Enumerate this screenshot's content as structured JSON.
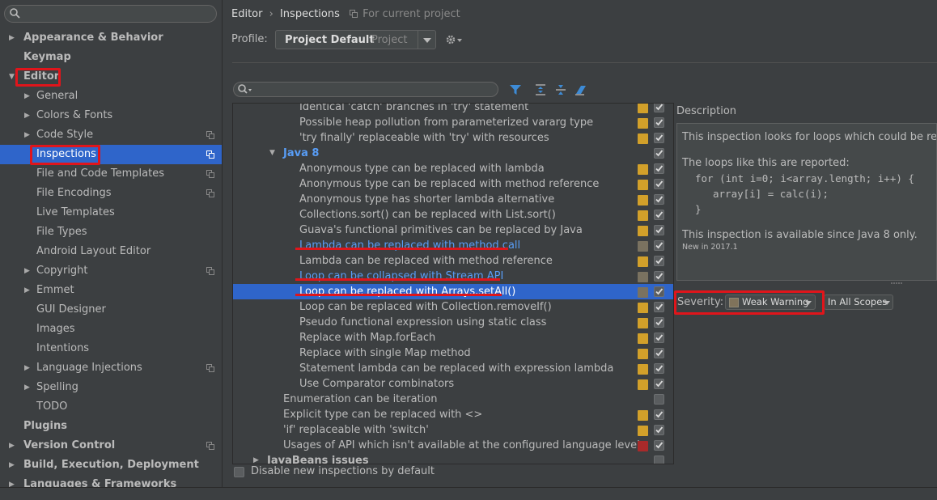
{
  "sidebar": {
    "items": [
      {
        "label": "Appearance & Behavior",
        "bold": true,
        "arrow": "▶"
      },
      {
        "label": "Keymap",
        "bold": true,
        "arrow": ""
      },
      {
        "label": "Editor",
        "bold": true,
        "arrow": "▼"
      },
      {
        "label": "General",
        "bold": false,
        "arrow": "▶"
      },
      {
        "label": "Colors & Fonts",
        "bold": false,
        "arrow": "▶"
      },
      {
        "label": "Code Style",
        "bold": false,
        "arrow": "▶"
      },
      {
        "label": "Inspections",
        "bold": false,
        "arrow": ""
      },
      {
        "label": "File and Code Templates",
        "bold": false,
        "arrow": ""
      },
      {
        "label": "File Encodings",
        "bold": false,
        "arrow": ""
      },
      {
        "label": "Live Templates",
        "bold": false,
        "arrow": ""
      },
      {
        "label": "File Types",
        "bold": false,
        "arrow": ""
      },
      {
        "label": "Android Layout Editor",
        "bold": false,
        "arrow": ""
      },
      {
        "label": "Copyright",
        "bold": false,
        "arrow": "▶"
      },
      {
        "label": "Emmet",
        "bold": false,
        "arrow": "▶"
      },
      {
        "label": "GUI Designer",
        "bold": false,
        "arrow": ""
      },
      {
        "label": "Images",
        "bold": false,
        "arrow": ""
      },
      {
        "label": "Intentions",
        "bold": false,
        "arrow": ""
      },
      {
        "label": "Language Injections",
        "bold": false,
        "arrow": "▶"
      },
      {
        "label": "Spelling",
        "bold": false,
        "arrow": "▶"
      },
      {
        "label": "TODO",
        "bold": false,
        "arrow": ""
      },
      {
        "label": "Plugins",
        "bold": true,
        "arrow": ""
      },
      {
        "label": "Version Control",
        "bold": true,
        "arrow": "▶"
      },
      {
        "label": "Build, Execution, Deployment",
        "bold": true,
        "arrow": "▶"
      },
      {
        "label": "Languages & Frameworks",
        "bold": true,
        "arrow": "▶"
      }
    ]
  },
  "header": {
    "crumb1": "Editor",
    "crumb_sep": "›",
    "crumb2": "Inspections",
    "scope_note": "For current project",
    "profile_label": "Profile:",
    "profile_value": "Project Default",
    "profile_kind": "Project"
  },
  "tree": {
    "rows": [
      {
        "text": "Identical 'catch' branches in 'try' statement",
        "sev": "#d2a02a",
        "checked": true
      },
      {
        "text": "Possible heap pollution from parameterized vararg type",
        "sev": "#d2a02a",
        "checked": true
      },
      {
        "text": "'try finally' replaceable with 'try' with resources",
        "sev": "#d2a02a",
        "checked": true
      },
      {
        "text": "Java 8",
        "sev": "",
        "checked": true,
        "group": true
      },
      {
        "text": "Anonymous type can be replaced with lambda",
        "sev": "#d2a02a",
        "checked": true
      },
      {
        "text": "Anonymous type can be replaced with method reference",
        "sev": "#d2a02a",
        "checked": true
      },
      {
        "text": "Anonymous type has shorter lambda alternative",
        "sev": "#d2a02a",
        "checked": true
      },
      {
        "text": "Collections.sort() can be replaced with List.sort()",
        "sev": "#d2a02a",
        "checked": true
      },
      {
        "text": "Guava's functional primitives can be replaced by Java",
        "sev": "#d2a02a",
        "checked": true
      },
      {
        "text": "Lambda can be replaced with method call",
        "sev": "#7a7260",
        "checked": true,
        "link": true
      },
      {
        "text": "Lambda can be replaced with method reference",
        "sev": "#d2a02a",
        "checked": true
      },
      {
        "text": "Loop can be collapsed with Stream API",
        "sev": "#7a7260",
        "checked": true,
        "link": true
      },
      {
        "text": "Loop can be replaced with Arrays.setAll()",
        "sev": "#7a7260",
        "checked": true,
        "selected": true
      },
      {
        "text": "Loop can be replaced with Collection.removeIf()",
        "sev": "#d2a02a",
        "checked": true
      },
      {
        "text": "Pseudo functional expression using static class",
        "sev": "#d2a02a",
        "checked": true
      },
      {
        "text": "Replace with Map.forEach",
        "sev": "#d2a02a",
        "checked": true
      },
      {
        "text": "Replace with single Map method",
        "sev": "#d2a02a",
        "checked": true
      },
      {
        "text": "Statement lambda can be replaced with expression lambda",
        "sev": "#d2a02a",
        "checked": true
      },
      {
        "text": "Use Comparator combinators",
        "sev": "#d2a02a",
        "checked": true
      },
      {
        "text": "Enumeration can be iteration",
        "sev": "",
        "checked": false,
        "level": 1
      },
      {
        "text": "Explicit type can be replaced with <>",
        "sev": "#d2a02a",
        "checked": true,
        "level": 1
      },
      {
        "text": "'if' replaceable with 'switch'",
        "sev": "#d2a02a",
        "checked": true,
        "level": 1
      },
      {
        "text": "Usages of API which isn't available at the configured language level",
        "sev": "#a82a2a",
        "checked": true,
        "level": 1
      },
      {
        "text": "JavaBeans issues",
        "sev": "",
        "checked": false,
        "group": true,
        "level": 0
      }
    ]
  },
  "description": {
    "title": "Description",
    "line1": "This inspection looks for loops which could be replaced",
    "line2": "The loops like this are reported:",
    "code1": "for (int i=0; i<array.length; i++) {",
    "code2": "   array[i] = calc(i);",
    "code3": "}",
    "line3": "This inspection is available since Java 8 only.",
    "line4": "New in 2017.1"
  },
  "severity": {
    "label": "Severity:",
    "value": "Weak Warning",
    "scope": "In All Scopes"
  },
  "footer": {
    "disable_label": "Disable new inspections by default"
  }
}
